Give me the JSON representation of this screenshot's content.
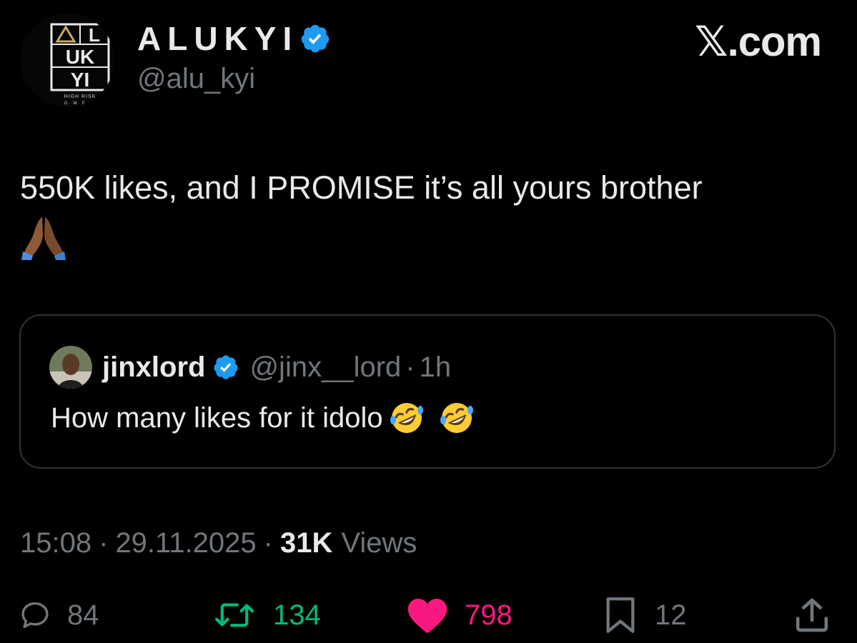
{
  "profile": {
    "display_name": "ALUKYI",
    "handle": "@alu_kyi",
    "avatar_logo": {
      "letters_row1": "L",
      "letters_row2": "UK",
      "letters_row3": "YI",
      "tagline_line1": "HIGH RISK",
      "tagline_line2": "G M E R"
    }
  },
  "brand": {
    "label": "𝕏.com"
  },
  "tweet": {
    "text": "550K likes, and I PROMISE it’s all yours brother"
  },
  "quote": {
    "name": "jinxlord",
    "handle": "@jinx__lord",
    "dot": "·",
    "time": "1h",
    "text": "How many likes for it idolo"
  },
  "meta": {
    "time": "15:08",
    "sep1": "·",
    "date": "29.11.2025",
    "sep2": "·",
    "views_count": "31K",
    "views_label": "Views"
  },
  "actions": {
    "replies": "84",
    "reposts": "134",
    "likes": "798",
    "bookmarks": "12"
  },
  "colors": {
    "background": "#000000",
    "text_primary": "#e7e9ea",
    "text_secondary": "#71767b",
    "verified_blue": "#1d9bf0",
    "repost_green": "#00ba7c",
    "like_pink": "#f91880",
    "card_border": "#2f3336"
  },
  "icons": {
    "reply": "reply-icon",
    "repost": "repost-icon",
    "like": "heart-icon",
    "bookmark": "bookmark-icon",
    "share": "share-icon",
    "verified": "verified-badge-icon",
    "pray": "folded-hands-emoji",
    "laugh": "rolling-on-floor-laughing-emoji"
  }
}
